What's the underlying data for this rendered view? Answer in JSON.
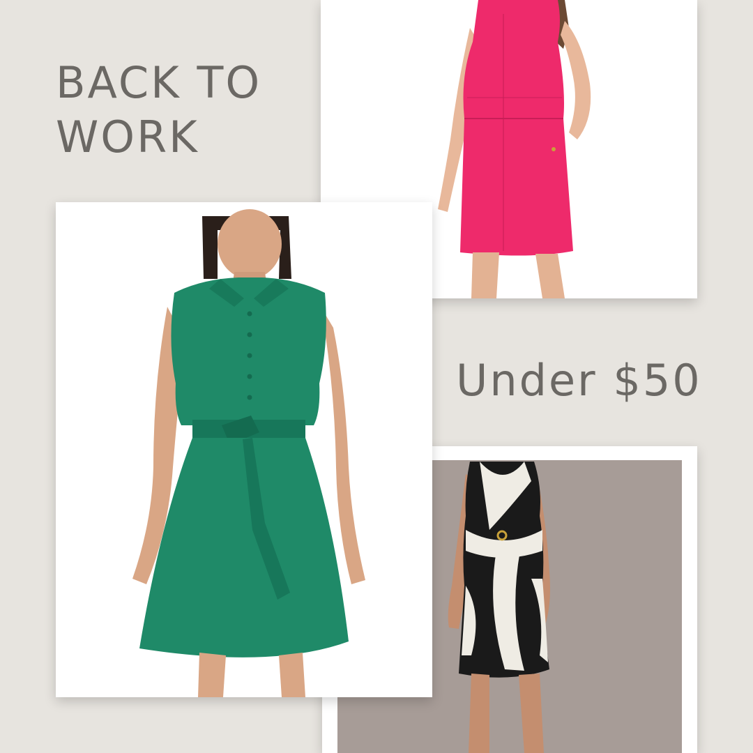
{
  "headline": {
    "line1": "BACK TO",
    "line2": "WORK"
  },
  "subheading": "Under $50",
  "colors": {
    "background": "#e7e4df",
    "text": "#6b6864",
    "green_dress": "#1f8a68",
    "pink_dress": "#ee2a6b",
    "bw_dress_dark": "#1a1a1a",
    "bw_dress_light": "#efece4",
    "taupe_backdrop": "#a79c97"
  },
  "products": [
    {
      "name": "pink-sleeveless-sheath-dress",
      "color": "pink"
    },
    {
      "name": "green-sleeveless-shirt-dress",
      "color": "green"
    },
    {
      "name": "black-white-print-wrap-dress",
      "color": "black-white"
    }
  ]
}
